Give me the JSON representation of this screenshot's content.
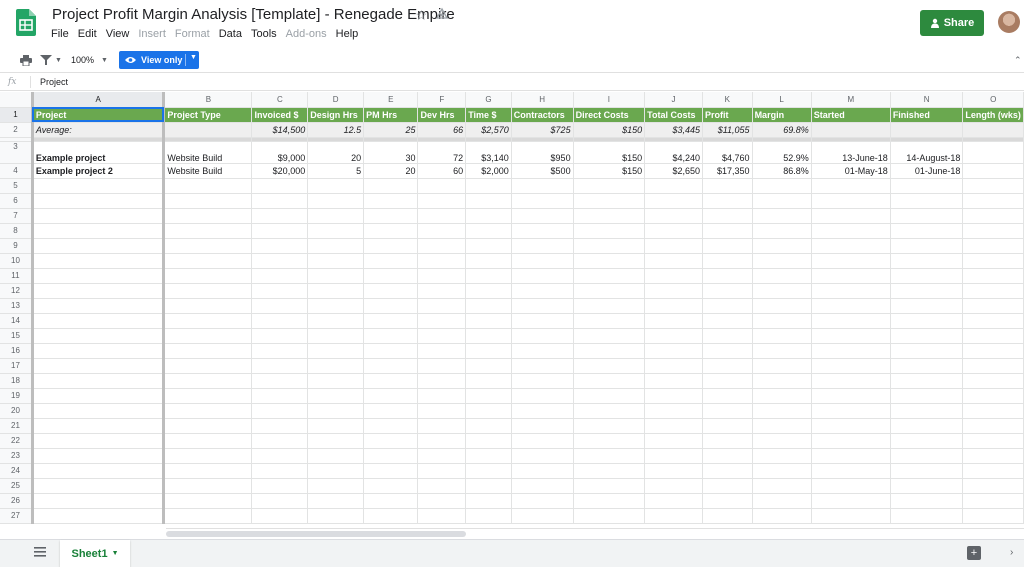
{
  "doc": {
    "title": "Project Profit Margin Analysis [Template] - Renegade Empire"
  },
  "menu": [
    "File",
    "Edit",
    "View",
    "Insert",
    "Format",
    "Data",
    "Tools",
    "Add-ons",
    "Help"
  ],
  "menu_disabled": [
    "Insert",
    "Format",
    "Add-ons"
  ],
  "share": {
    "label": "Share"
  },
  "toolbar": {
    "zoom": "100%",
    "view_mode": "View only"
  },
  "formula_bar": {
    "fx": "fx",
    "value": "Project"
  },
  "columns": [
    "A",
    "B",
    "C",
    "D",
    "E",
    "F",
    "G",
    "H",
    "I",
    "J",
    "K",
    "L",
    "M",
    "N",
    "O"
  ],
  "header_row": [
    "Project",
    "Project Type",
    "Invoiced $",
    "Design Hrs",
    "PM Hrs",
    "Dev Hrs",
    "Time $",
    "Contractors",
    "Direct Costs",
    "Total Costs",
    "Profit",
    "Margin",
    "Started",
    "Finished",
    "Length (wks)"
  ],
  "average_row": [
    "Average:",
    "",
    "$14,500",
    "12.5",
    "25",
    "66",
    "$2,570",
    "$725",
    "$150",
    "$3,445",
    "$11,055",
    "69.8%",
    "",
    "",
    ""
  ],
  "data_rows": [
    {
      "row": "3",
      "cells": [
        "Example project",
        "Website Build",
        "$9,000",
        "20",
        "30",
        "72",
        "$3,140",
        "$950",
        "$150",
        "$4,240",
        "$4,760",
        "52.9%",
        "13-June-18",
        "14-August-18",
        ""
      ]
    },
    {
      "row": "4",
      "cells": [
        "Example project 2",
        "Website Build",
        "$20,000",
        "5",
        "20",
        "60",
        "$2,000",
        "$500",
        "$150",
        "$2,650",
        "$17,350",
        "86.8%",
        "01-May-18",
        "01-June-18",
        ""
      ]
    }
  ],
  "empty_rows": [
    "5",
    "6",
    "7",
    "8",
    "9",
    "10",
    "11",
    "12",
    "13",
    "14",
    "15",
    "16",
    "17",
    "18",
    "19",
    "20",
    "21",
    "22",
    "23",
    "24",
    "25",
    "26",
    "27"
  ],
  "sheet_tab": {
    "label": "Sheet1"
  },
  "colors": {
    "header_green": "#6aa84f",
    "share_green": "#2d8a3e",
    "view_blue": "#1a73e8"
  }
}
